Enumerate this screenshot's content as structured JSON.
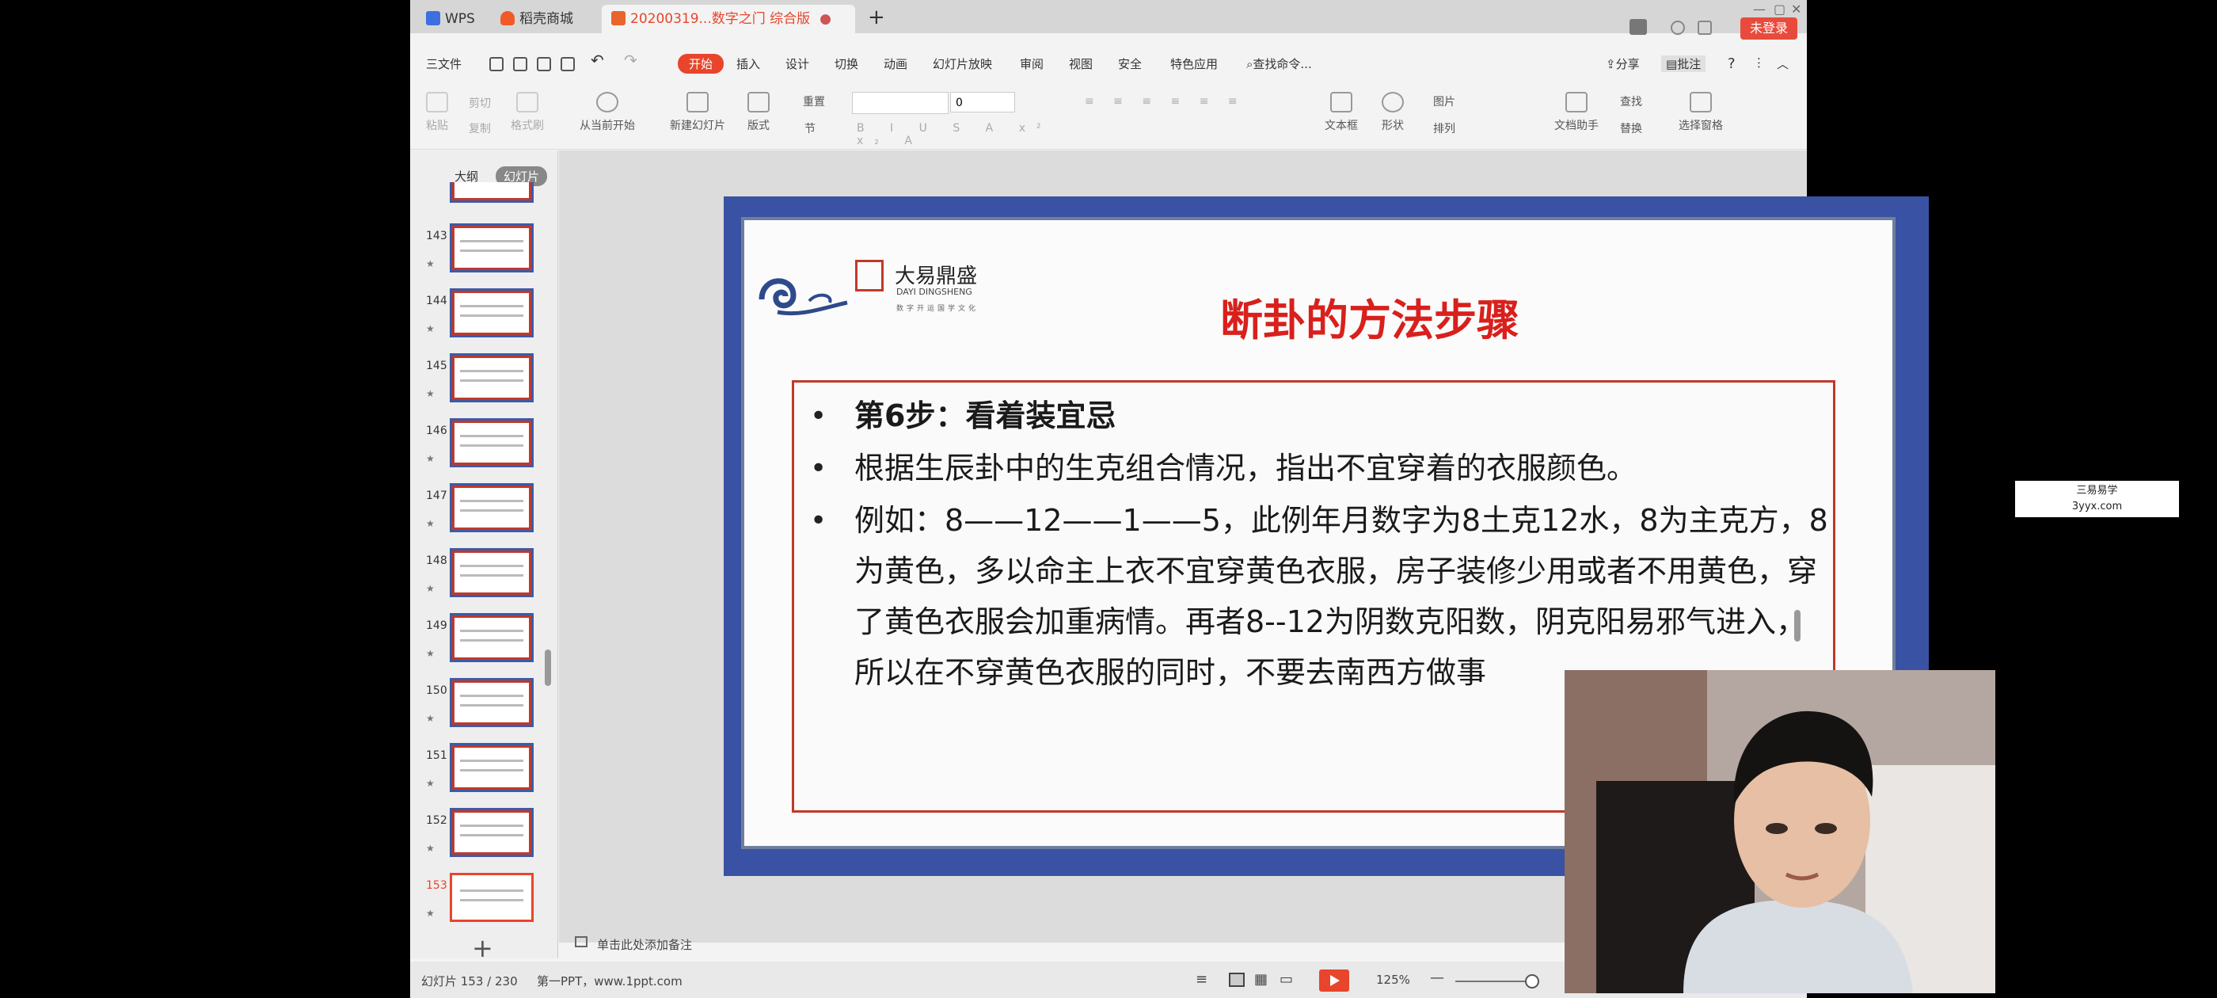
{
  "tabs": [
    {
      "label": "WPS"
    },
    {
      "label": "稻壳商城"
    },
    {
      "label": "20200319...数字之门 综合版"
    }
  ],
  "login_button": "未登录",
  "menu": {
    "file": "三文件",
    "items": [
      "开始",
      "插入",
      "设计",
      "切换",
      "动画",
      "幻灯片放映",
      "审阅",
      "视图",
      "安全",
      "特色应用"
    ],
    "search": "查找命令...",
    "share": "分享",
    "comment": "批注",
    "help": "?"
  },
  "ribbon": {
    "paste": "粘贴",
    "cut": "剪切",
    "copy": "复制",
    "format_painter": "格式刷",
    "play_from_current": "从当前开始",
    "new_slide": "新建幻灯片",
    "layout": "版式",
    "reset": "重置",
    "section": "节",
    "font_size": "0",
    "text_box": "文本框",
    "shapes": "形状",
    "picture": "图片",
    "arrange": "排列",
    "doc_assistant": "文档助手",
    "find": "查找",
    "replace": "替换",
    "select_pane": "选择窗格"
  },
  "left_pane": {
    "tab_outline": "大纲",
    "tab_slides": "幻灯片",
    "thumbnails": [
      "143",
      "144",
      "145",
      "146",
      "147",
      "148",
      "149",
      "150",
      "151",
      "152",
      "153"
    ],
    "add": "+"
  },
  "slide": {
    "logo_cn": "大易鼎盛",
    "logo_en": "DAYI DINGSHENG",
    "logo_tag": "数字开运国学文化",
    "title": "断卦的方法步骤",
    "bullets": [
      "第6步：看着装宜忌",
      "根据生辰卦中的生克组合情况，指出不宜穿着的衣服颜色。",
      "例如：8——12——1——5，此例年月数字为8土克12水，8为主克方，8为黄色，多以命主上衣不宜穿黄色衣服，房子装修少用或者不用黄色，穿了黄色衣服会加重病情。再者8--12为阴数克阳数，阴克阳易邪气进入，所以在不穿黄色衣服的同时，不要去南西方做事"
    ]
  },
  "notes_placeholder": "单击此处添加备注",
  "status": {
    "slide_counter": "幻灯片 153 / 230",
    "theme": "第一PPT，www.1ppt.com",
    "zoom": "125%"
  },
  "watermark": {
    "line1": "三易易学",
    "line2": "3yyx.com"
  },
  "colors": {
    "accent": "#e8452c",
    "slide_border": "#3a52a3",
    "title_red": "#d8201c"
  }
}
